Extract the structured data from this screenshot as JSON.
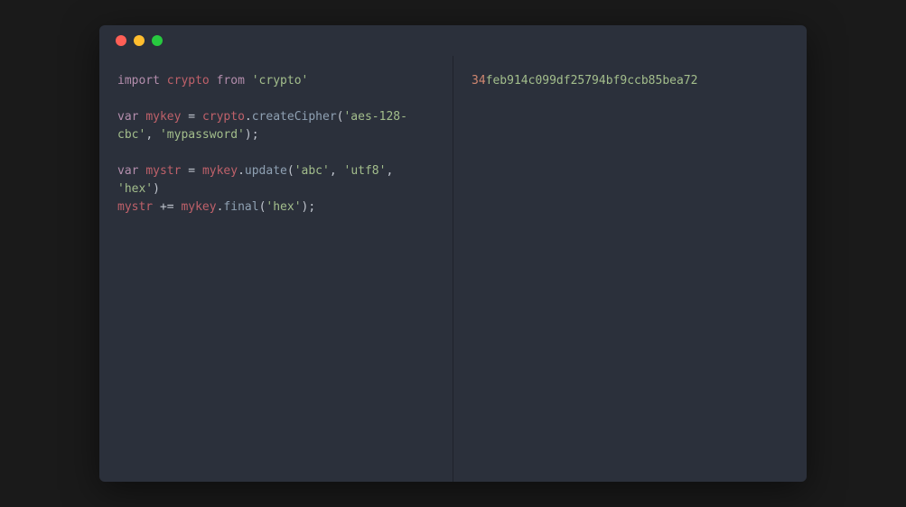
{
  "window": {
    "controls": [
      "close",
      "minimize",
      "zoom"
    ]
  },
  "code": {
    "tokens": [
      [
        "kw",
        "import"
      ],
      [
        "sp",
        " "
      ],
      [
        "var",
        "crypto"
      ],
      [
        "sp",
        " "
      ],
      [
        "kw",
        "from"
      ],
      [
        "sp",
        " "
      ],
      [
        "str",
        "'crypto'"
      ],
      [
        "nl",
        ""
      ],
      [
        "nl",
        ""
      ],
      [
        "kw",
        "var"
      ],
      [
        "sp",
        " "
      ],
      [
        "var",
        "mykey"
      ],
      [
        "sp",
        " "
      ],
      [
        "op",
        "="
      ],
      [
        "sp",
        " "
      ],
      [
        "var",
        "crypto"
      ],
      [
        "op",
        "."
      ],
      [
        "fn",
        "createCipher"
      ],
      [
        "op",
        "("
      ],
      [
        "str",
        "'aes-128-cbc'"
      ],
      [
        "op",
        ","
      ],
      [
        "sp",
        " "
      ],
      [
        "str",
        "'mypassword'"
      ],
      [
        "op",
        ")"
      ],
      [
        "op",
        ";"
      ],
      [
        "nl",
        ""
      ],
      [
        "nl",
        ""
      ],
      [
        "kw",
        "var"
      ],
      [
        "sp",
        " "
      ],
      [
        "var",
        "mystr"
      ],
      [
        "sp",
        " "
      ],
      [
        "op",
        "="
      ],
      [
        "sp",
        " "
      ],
      [
        "var",
        "mykey"
      ],
      [
        "op",
        "."
      ],
      [
        "fn",
        "update"
      ],
      [
        "op",
        "("
      ],
      [
        "str",
        "'abc'"
      ],
      [
        "op",
        ","
      ],
      [
        "sp",
        " "
      ],
      [
        "str",
        "'utf8'"
      ],
      [
        "op",
        ","
      ],
      [
        "sp",
        " "
      ],
      [
        "str",
        "'hex'"
      ],
      [
        "op",
        ")"
      ],
      [
        "nl",
        ""
      ],
      [
        "var",
        "mystr"
      ],
      [
        "sp",
        " "
      ],
      [
        "op",
        "+="
      ],
      [
        "sp",
        " "
      ],
      [
        "var",
        "mykey"
      ],
      [
        "op",
        "."
      ],
      [
        "fn",
        "final"
      ],
      [
        "op",
        "("
      ],
      [
        "str",
        "'hex'"
      ],
      [
        "op",
        ")"
      ],
      [
        "op",
        ";"
      ]
    ]
  },
  "output": {
    "prefix": "34",
    "hex": "feb914c099df25794bf9ccb85bea72"
  }
}
